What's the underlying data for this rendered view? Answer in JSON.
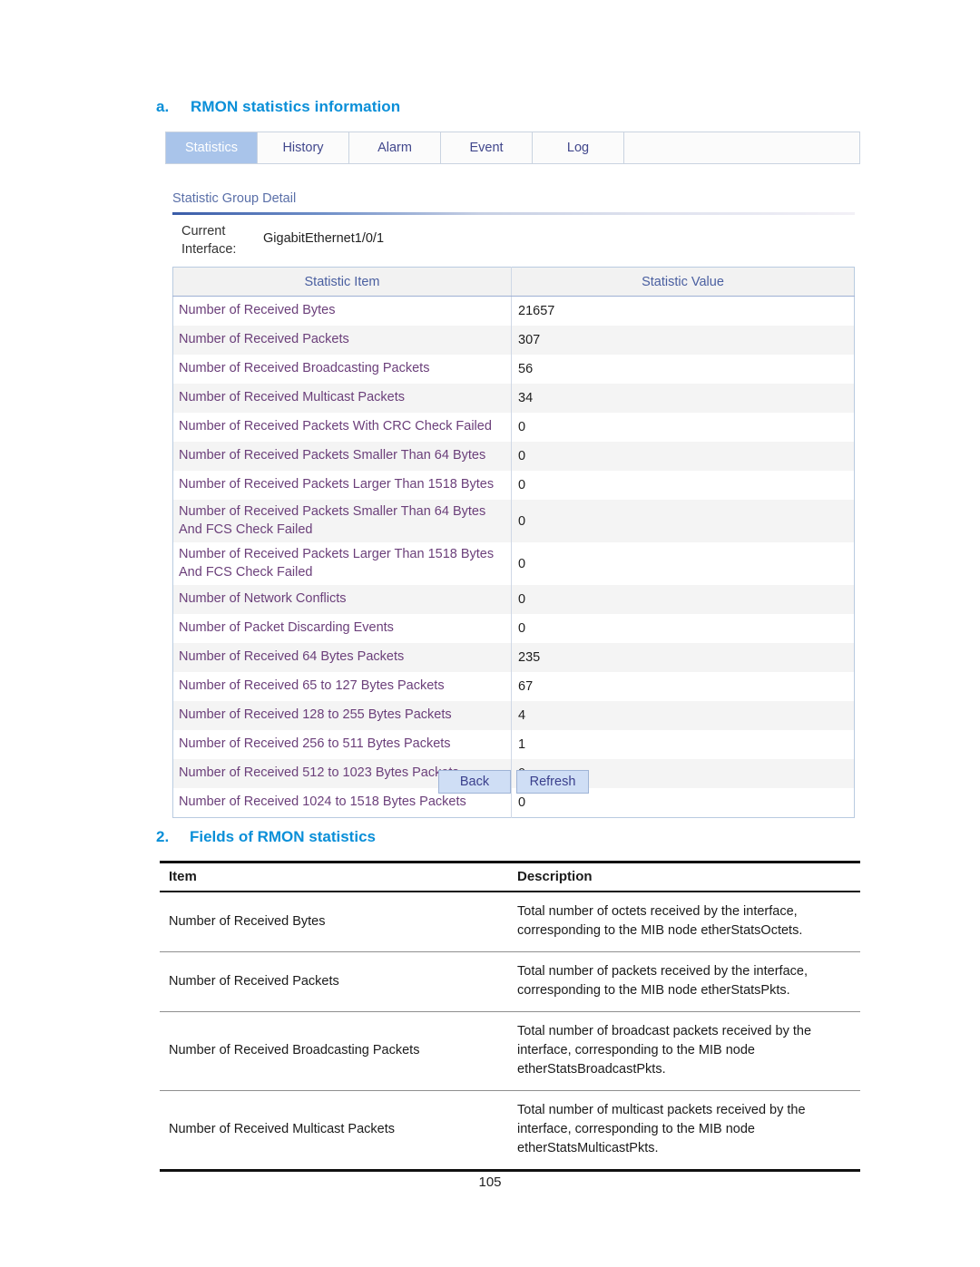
{
  "document": {
    "page_number": "105"
  },
  "section_a": {
    "marker": "a.",
    "title": "RMON statistics information"
  },
  "webui": {
    "tabs": [
      {
        "label": "Statistics",
        "active": true
      },
      {
        "label": "History",
        "active": false
      },
      {
        "label": "Alarm",
        "active": false
      },
      {
        "label": "Event",
        "active": false
      },
      {
        "label": "Log",
        "active": false
      }
    ],
    "group_title": "Statistic Group Detail",
    "interface_label": "Current Interface:",
    "interface_value": "GigabitEthernet1/0/1",
    "table": {
      "headers": [
        "Statistic Item",
        "Statistic Value"
      ],
      "rows": [
        {
          "item": "Number of Received Bytes",
          "value": "21657"
        },
        {
          "item": "Number of Received Packets",
          "value": "307"
        },
        {
          "item": "Number of Received Broadcasting Packets",
          "value": "56"
        },
        {
          "item": "Number of Received Multicast Packets",
          "value": "34"
        },
        {
          "item": "Number of Received Packets With CRC Check Failed",
          "value": "0"
        },
        {
          "item": "Number of Received Packets Smaller Than 64 Bytes",
          "value": "0"
        },
        {
          "item": "Number of Received Packets Larger Than 1518 Bytes",
          "value": "0"
        },
        {
          "item": "Number of Received Packets Smaller Than 64 Bytes And FCS Check Failed",
          "value": "0"
        },
        {
          "item": "Number of Received Packets Larger Than 1518 Bytes And FCS Check Failed",
          "value": "0"
        },
        {
          "item": "Number of Network Conflicts",
          "value": "0"
        },
        {
          "item": "Number of Packet Discarding Events",
          "value": "0"
        },
        {
          "item": "Number of Received 64 Bytes Packets",
          "value": "235"
        },
        {
          "item": "Number of Received 65 to 127 Bytes Packets",
          "value": "67"
        },
        {
          "item": "Number of Received 128 to 255 Bytes Packets",
          "value": "4"
        },
        {
          "item": "Number of Received 256 to 511 Bytes Packets",
          "value": "1"
        },
        {
          "item": "Number of Received 512 to 1023 Bytes Packets",
          "value": "0"
        },
        {
          "item": "Number of Received 1024 to 1518 Bytes Packets",
          "value": "0"
        }
      ]
    },
    "buttons": {
      "back": "Back",
      "refresh": "Refresh"
    },
    "colors": {
      "active_tab_bg": "#a9c4ea",
      "panel_border": "#b9cbe0",
      "item_text": "#6b3f7a",
      "button_bg": "#cfdef5"
    }
  },
  "section_2": {
    "marker": "2.",
    "title": "Fields of RMON statistics",
    "table": {
      "headers": [
        "Item",
        "Description"
      ],
      "rows": [
        {
          "item": "Number of Received Bytes",
          "description": "Total number of octets received by the interface, corresponding to the MIB node etherStatsOctets."
        },
        {
          "item": "Number of Received Packets",
          "description": "Total number of packets received by the interface, corresponding to the MIB node etherStatsPkts."
        },
        {
          "item": "Number of Received Broadcasting Packets",
          "description": "Total number of broadcast packets received by the interface, corresponding to the MIB node etherStatsBroadcastPkts."
        },
        {
          "item": "Number of Received Multicast Packets",
          "description": "Total number of multicast packets received by the interface, corresponding to the MIB node etherStatsMulticastPkts."
        }
      ]
    }
  },
  "heading_color": "#0a8fd8"
}
